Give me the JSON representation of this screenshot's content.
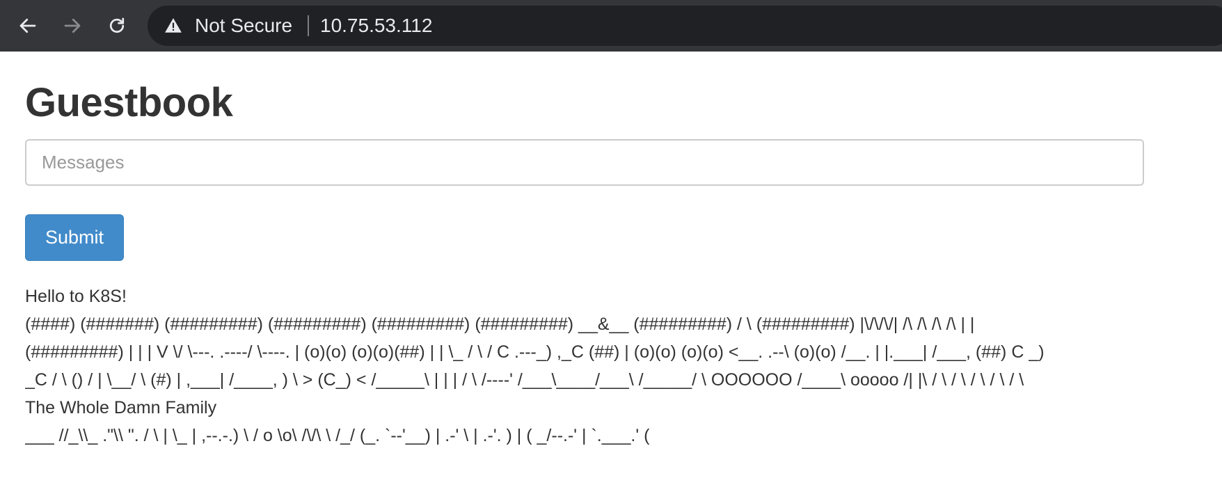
{
  "browser": {
    "security_label": "Not Secure",
    "url": "10.75.53.112"
  },
  "page": {
    "title": "Guestbook",
    "input_placeholder": "Messages",
    "input_value": "",
    "submit_label": "Submit"
  },
  "entries": [
    "Hello to K8S!",
    "(####) (#######) (#########) (#########) (#########) (#########) __&__ (#########) / \\ (#########) |\\/\\/\\/| /\\ /\\ /\\ /\\ | |",
    "(#########) | | | V \\/ \\---. .----/ \\----. | (o)(o) (o)(o)(##) | | \\_ / \\ / C .---_) ,_C (##) | (o)(o) (o)(o) <__. .--\\ (o)(o) /__. | |.___| /___, (##) C _)",
    "_C / \\ () / | \\__/ \\ (#) | ,___| /____, ) \\ > (C_) < /_____\\ | | | / \\ /----' /___\\____/___\\ /_____/ \\ OOOOOO /____\\ ooooo /| |\\ / \\ / \\ / \\ / \\ / \\",
    "The Whole Damn Family",
    "___ //_\\\\_ .\"\\\\ \". / \\ | \\_ | ,--.-.) \\ / o \\o\\ /\\/\\ \\ /_/ (_. `--'__) | .-' \\ | .-'. ) | ( _/--.-' | `.___.' ("
  ]
}
